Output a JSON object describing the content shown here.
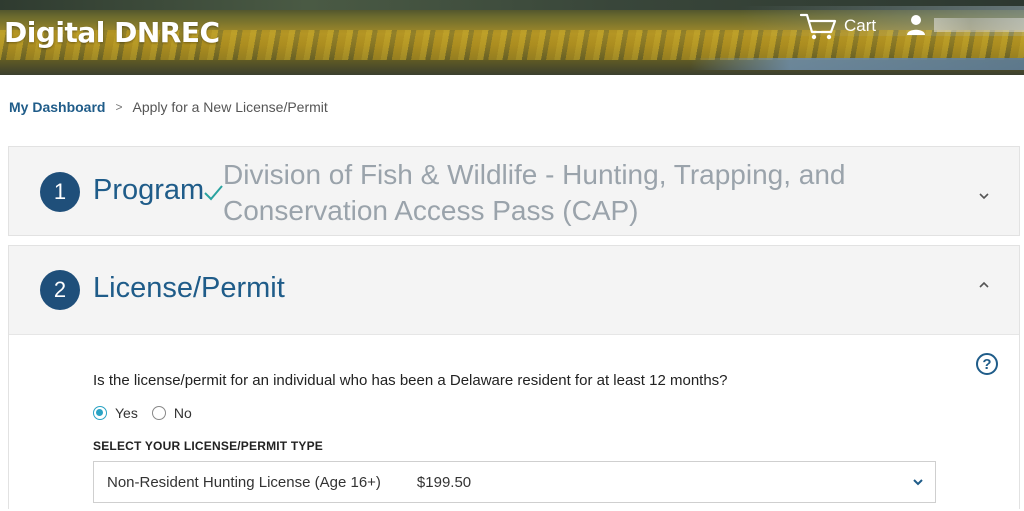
{
  "header": {
    "brand": "Digital DNREC",
    "cart_label": "Cart",
    "icons": {
      "cart": "cart-icon",
      "user": "user-icon"
    }
  },
  "breadcrumb": {
    "home": "My Dashboard",
    "separator": ">",
    "current": "Apply for a New License/Permit"
  },
  "steps": [
    {
      "number": "1",
      "title": "Program",
      "status_icon": "checkmark-icon",
      "value": "Division of Fish & Wildlife - Hunting, Trapping, and Conservation Access Pass (CAP)",
      "toggle_icon": "chevron-down-icon"
    },
    {
      "number": "2",
      "title": "License/Permit",
      "toggle_icon": "chevron-up-icon"
    }
  ],
  "form": {
    "help_icon": "?",
    "question": "Is the license/permit for an individual who has been a Delaware resident for at least 12 months?",
    "options": [
      {
        "label": "Yes",
        "selected": true
      },
      {
        "label": "No",
        "selected": false
      }
    ],
    "type_label": "SELECT YOUR LICENSE/PERMIT TYPE",
    "selected_type": "Non-Resident Hunting License (Age 16+)",
    "selected_price": "$199.50"
  },
  "colors": {
    "brand_blue": "#1f4f7a",
    "link_blue": "#1f5c89",
    "check_teal": "#2aa3a0",
    "radio_accent": "#2aa3c4"
  }
}
